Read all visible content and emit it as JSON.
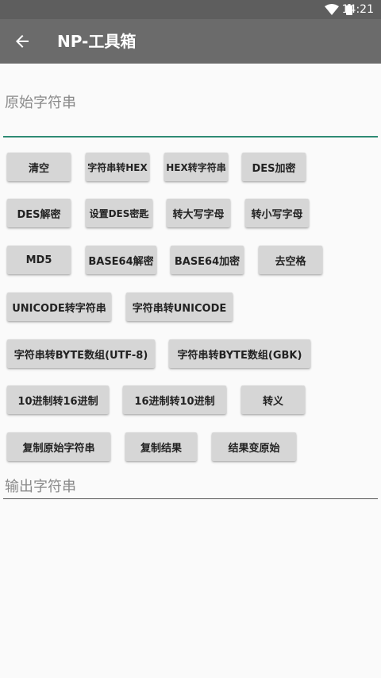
{
  "status_bar": {
    "time": "14:21",
    "icons": [
      "wifi-icon",
      "battery-icon"
    ]
  },
  "app_bar": {
    "title": "NP-工具箱",
    "back_icon": "arrow-left-icon"
  },
  "input": {
    "placeholder": "原始字符串",
    "accent_color": "#2e8b74"
  },
  "output": {
    "placeholder": "输出字符串"
  },
  "buttons": {
    "clear": "清空",
    "str_to_hex": "字符串转HEX",
    "hex_to_str": "HEX转字符串",
    "des_encrypt": "DES加密",
    "des_decrypt": "DES解密",
    "set_des_key": "设置DES密匙",
    "to_upper": "转大写字母",
    "to_lower": "转小写字母",
    "md5": "MD5",
    "base64_decode": "BASE64解密",
    "base64_encode": "BASE64加密",
    "remove_spaces": "去空格",
    "unicode_to_str": "UNICODE转字符串",
    "str_to_unicode": "字符串转UNICODE",
    "str_to_bytes_utf8": "字符串转BYTE数组(UTF-8)",
    "str_to_bytes_gbk": "字符串转BYTE数组(GBK)",
    "dec_to_hex": "10进制转16进制",
    "hex_to_dec": "16进制转10进制",
    "escape": "转义",
    "copy_original": "复制原始字符串",
    "copy_result": "复制结果",
    "result_to_original": "结果变原始"
  }
}
